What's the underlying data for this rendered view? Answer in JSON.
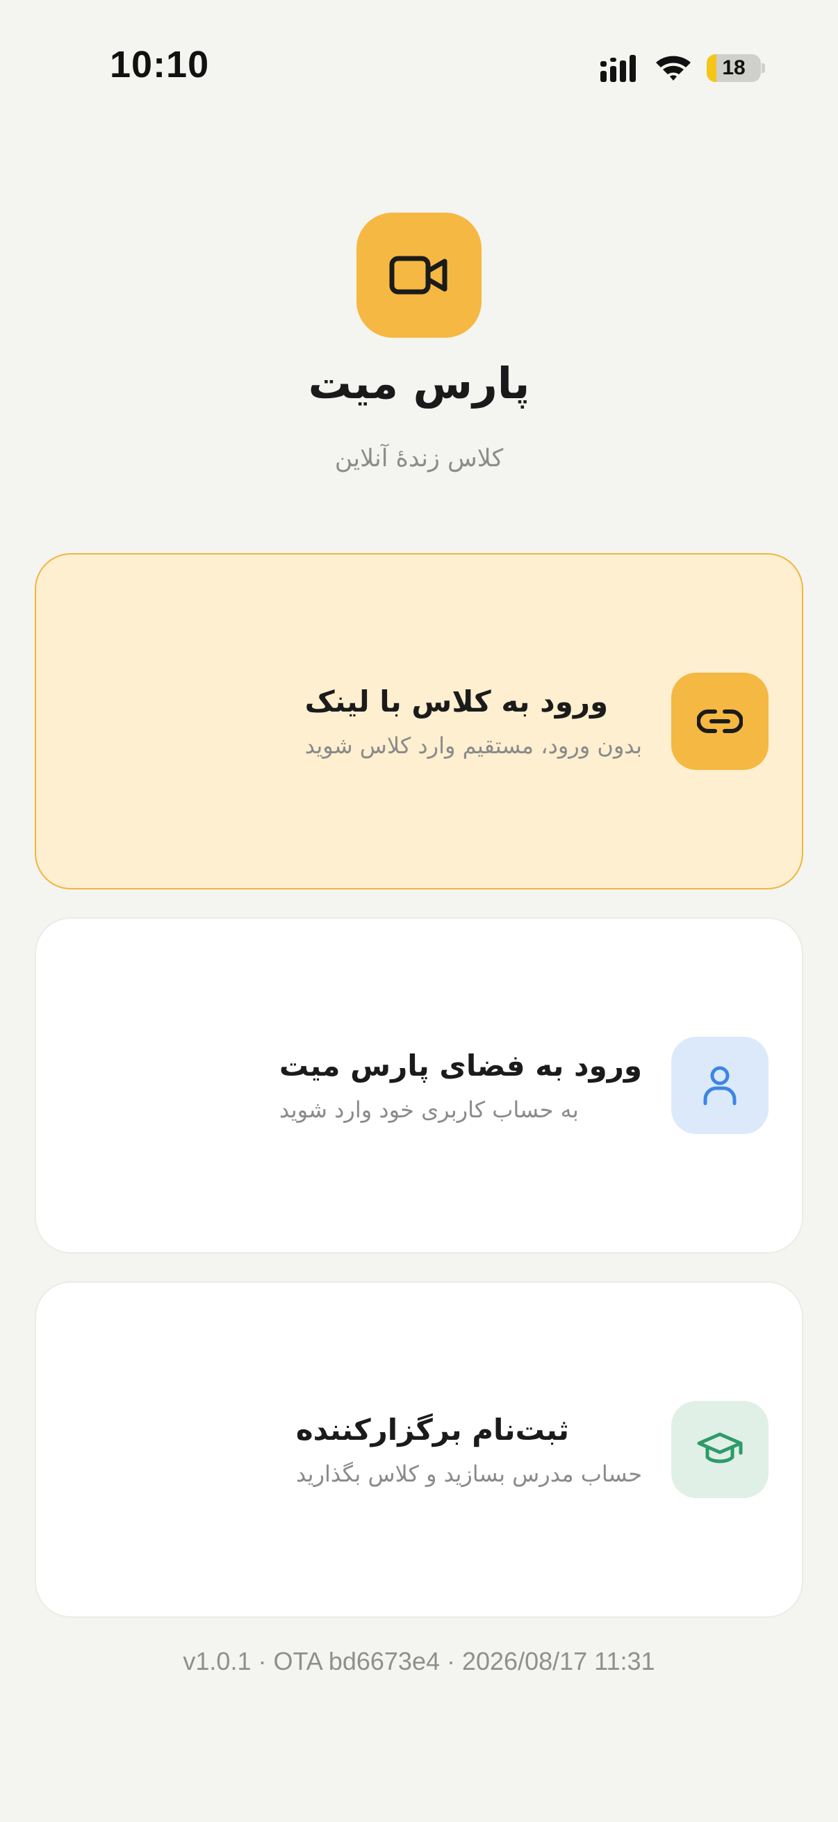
{
  "status_bar": {
    "time": "10:10",
    "battery": "18",
    "battery_level": 0.18
  },
  "app": {
    "title": "پارس میت",
    "subtitle": "کلاس زندهٔ آنلاین"
  },
  "options": [
    {
      "title": "ورود به کلاس با لینک",
      "description": "بدون ورود، مستقیم وارد کلاس شوید",
      "icon": "link-icon",
      "accent": "#f5b842"
    },
    {
      "title": "ورود به فضای پارس میت",
      "description": "به حساب کاربری خود وارد شوید",
      "icon": "user-icon",
      "accent": "#dce9fb"
    },
    {
      "title": "ثبت‌نام برگزارکننده",
      "description": "حساب مدرس بسازید و کلاس بگذارید",
      "icon": "graduation-cap-icon",
      "accent": "#e0f0e7"
    }
  ],
  "footer": {
    "version": "v1.0.1 · OTA bd6673e4 · 2026/08/17 11:31"
  }
}
